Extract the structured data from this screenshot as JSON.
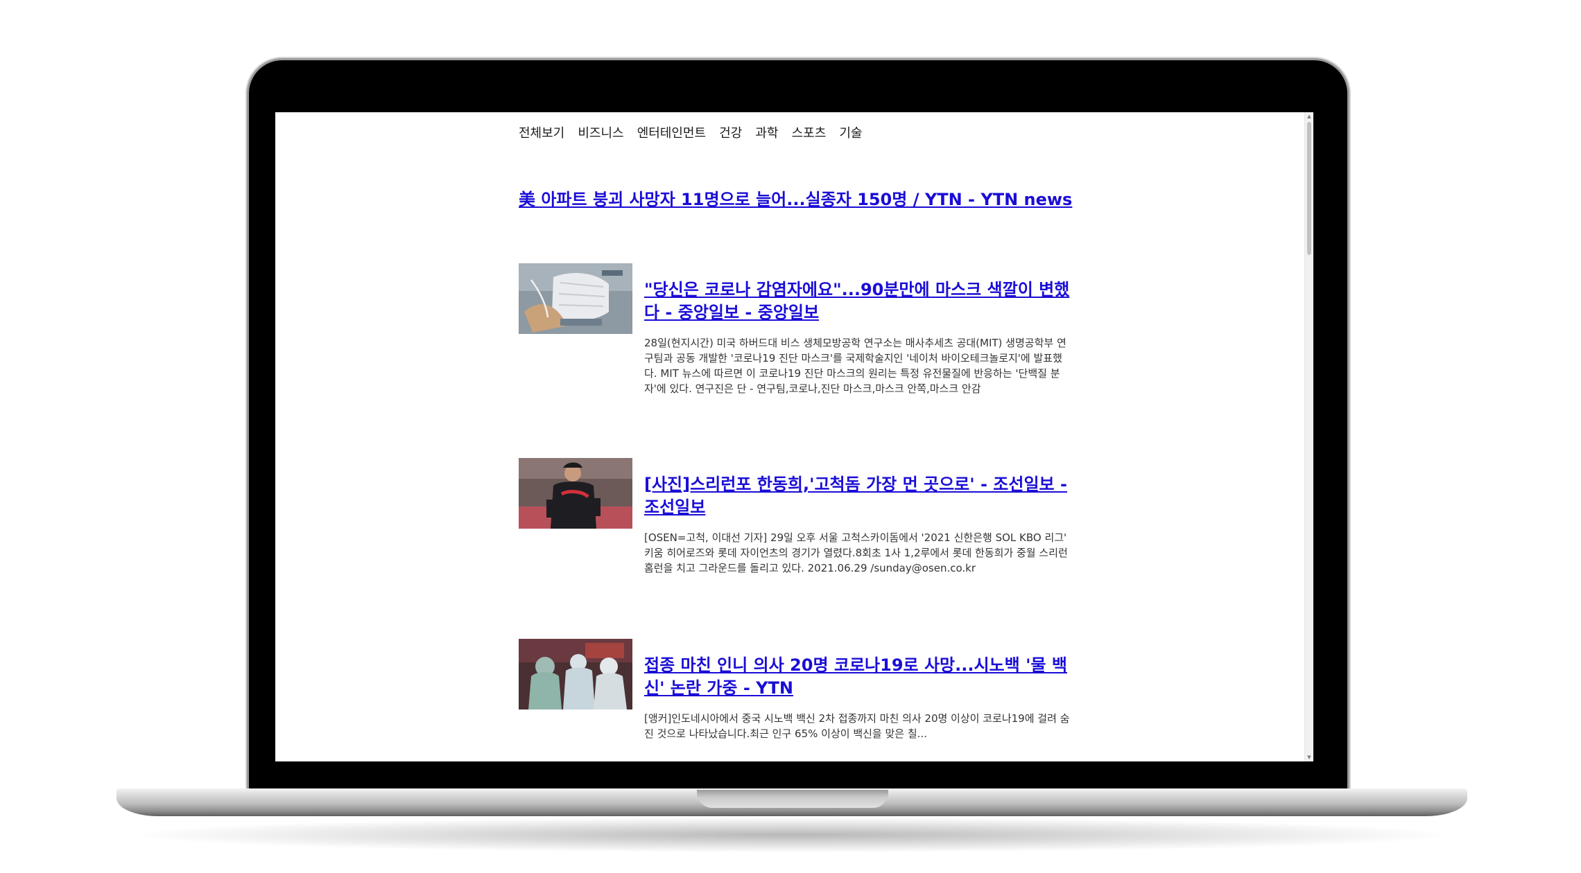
{
  "nav": {
    "items": [
      "전체보기",
      "비즈니스",
      "엔터테인먼트",
      "건강",
      "과학",
      "스포츠",
      "기술"
    ]
  },
  "headline": {
    "title": "美 아파트 붕괴 사망자 11명으로 늘어...실종자 150명 / YTN - YTN news"
  },
  "articles": [
    {
      "title": "\"당신은 코로나 감염자에요\"...90분만에 마스크 색깔이 변했다 - 중앙일보 - 중앙일보",
      "description": "28일(현지시간) 미국 하버드대 비스 생체모방공학 연구소는 매사추세츠 공대(MIT) 생명공학부 연구팀과 공동 개발한 '코로나19 진단 마스크'를 국제학술지인 '네이처 바이오테크놀로지'에 발표했다. MIT 뉴스에 따르면 이 코로나19 진단 마스크의 원리는 특정 유전물질에 반응하는 '단백질 분자'에 있다. 연구진은 단 - 연구팀,코로나,진단 마스크,마스크 안쪽,마스크 안감",
      "thumbnail": "face-mask-image"
    },
    {
      "title": "[사진]스리런포 한동희,'고척돔 가장 먼 곳으로' - 조선일보 - 조선일보",
      "description": "[OSEN=고척, 이대선 기자] 29일 오후 서울 고척스카이돔에서 '2021 신한은행 SOL KBO 리그' 키움 히어로즈와 롯데 자이언츠의 경기가 열렸다.8회초 1사 1,2루에서 롯데 한동희가 중월 스리런 홈런을 치고 그라운드를 돌리고 있다. 2021.06.29 /sunday@osen.co.kr",
      "thumbnail": "baseball-player-image"
    },
    {
      "title": "접종 마친 인니 의사 20명 코로나19로 사망...시노백 '물 백신' 논란 가중 - YTN",
      "description": "[앵커]인도네시아에서 중국 시노백 백신 2차 접종까지 마친 의사 20명 이상이 코로나19에 걸려 숨진 것으로 나타났습니다.최근 인구 65% 이상이 백신을 맞은 칠...",
      "thumbnail": "medical-staff-image"
    }
  ],
  "colors": {
    "link": "#1a0dd6",
    "text": "#333333",
    "bezel": "#000000"
  }
}
